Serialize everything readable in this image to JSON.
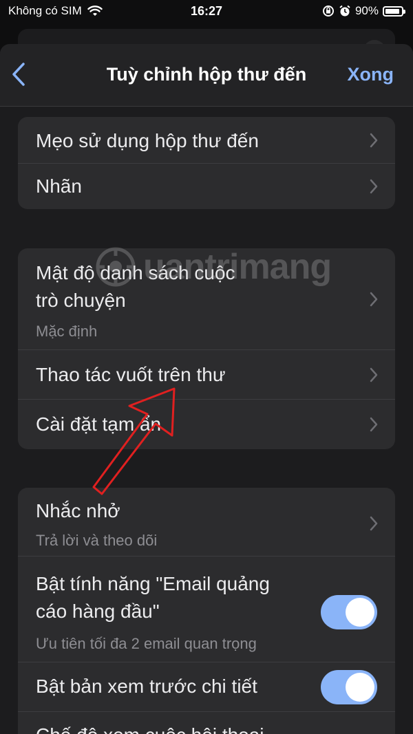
{
  "status_bar": {
    "carrier": "Không có SIM",
    "time": "16:27",
    "battery": "90%",
    "battery_level": 0.9
  },
  "nav": {
    "back_icon": "chevron-left-icon",
    "title": "Tuỳ chỉnh hộp thư đến",
    "done_label": "Xong"
  },
  "group1": [
    {
      "title": "Mẹo sử dụng hộp thư đến"
    },
    {
      "title": "Nhãn"
    }
  ],
  "group2": [
    {
      "title_line1": "Mật độ danh sách cuộc",
      "title_line2": "trò chuyện",
      "subtitle": "Mặc định"
    },
    {
      "title": "Thao tác vuốt trên thư"
    },
    {
      "title": "Cài đặt tạm ẩn"
    }
  ],
  "group3": [
    {
      "title": "Nhắc nhở",
      "subtitle": "Trả lời và theo dõi"
    },
    {
      "title_line1": "Bật tính năng \"Email quảng",
      "title_line2": "cáo hàng đầu\"",
      "subtitle": "Ưu tiên tối đa 2 email quan trọng",
      "toggle_on": true
    },
    {
      "title": "Bật bản xem trước chi tiết",
      "toggle_on": true
    },
    {
      "title": "Chế độ xem cuộc hội thoại"
    }
  ],
  "watermark": "uantrimang",
  "colors": {
    "accent": "#8ab4f8",
    "background": "#1c1c1e",
    "cell": "#2c2c2e",
    "annotation_arrow": "#e02020"
  }
}
